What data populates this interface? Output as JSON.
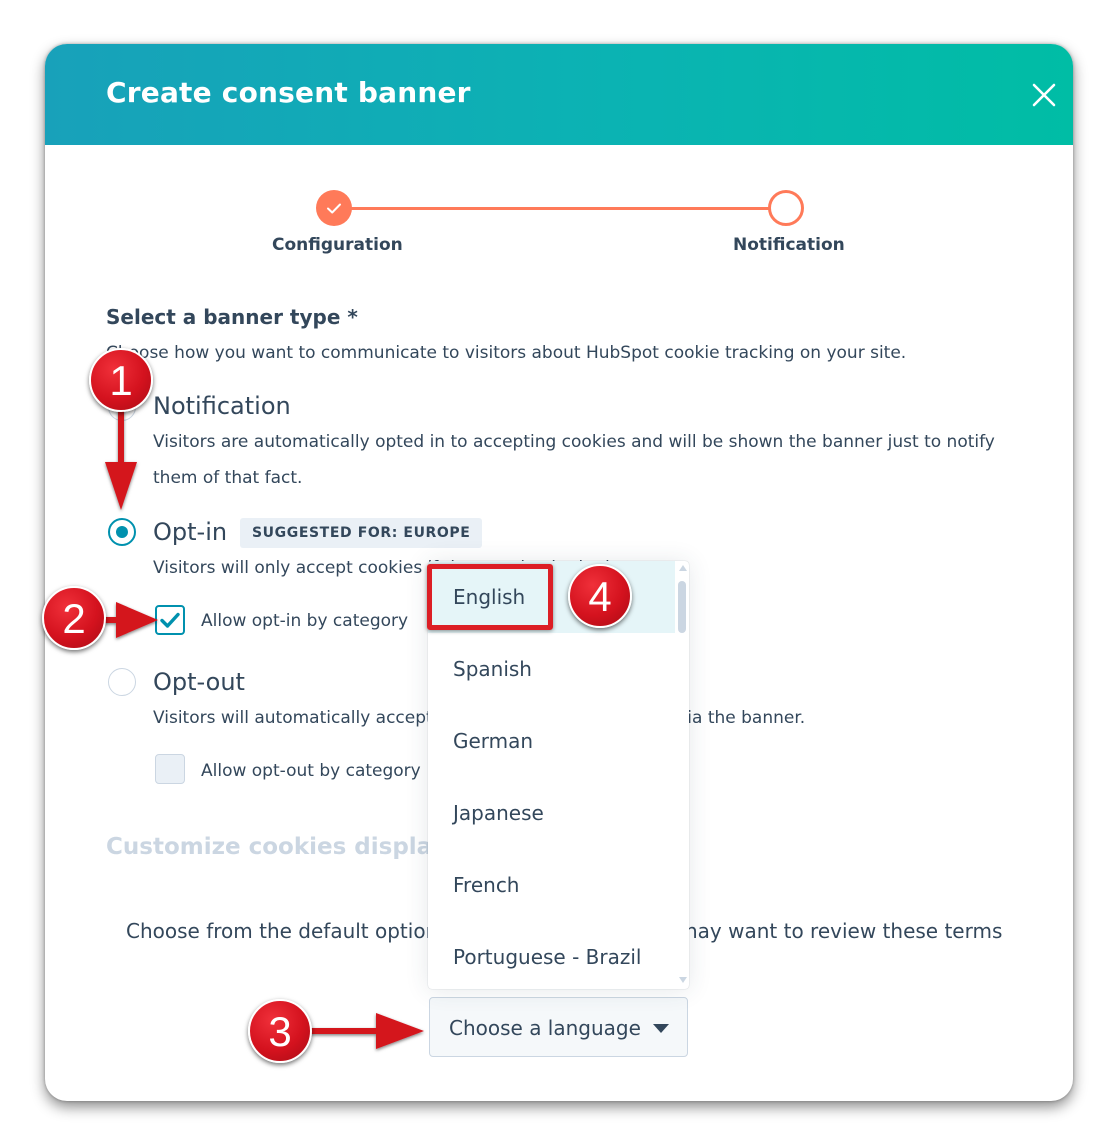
{
  "modal": {
    "title": "Create consent banner",
    "close_icon": "close-icon"
  },
  "stepper": {
    "steps": [
      {
        "label": "Configuration",
        "state": "completed"
      },
      {
        "label": "Notification",
        "state": "pending"
      }
    ],
    "accent_color": "#ff7a59"
  },
  "banner_type": {
    "title": "Select a banner type *",
    "description": "Choose how you want to communicate to visitors about HubSpot cookie tracking on your site.",
    "options": [
      {
        "label": "Notification",
        "selected": false,
        "description_line1": "Visitors are automatically opted in to accepting cookies and will be shown the banner just to notify",
        "description_line2": "them of that fact."
      },
      {
        "label": "Opt-in",
        "selected": true,
        "badge": "SUGGESTED FOR: EUROPE",
        "description": "Visitors will only accept cookies if they opt in via the banner.",
        "checkbox_label": "Allow opt-in by category",
        "checkbox_checked": true
      },
      {
        "label": "Opt-out",
        "selected": false,
        "description": "Visitors will automatically accept cookies unless they opt out via the banner.",
        "checkbox_label": "Allow opt-out by category",
        "checkbox_checked": false
      }
    ]
  },
  "customize": {
    "title": "Customize cookies display",
    "text_left": "Choose from the default option",
    "text_right": "nay want to review these terms"
  },
  "language": {
    "button_label": "Choose a language",
    "options": [
      "English",
      "Spanish",
      "German",
      "Japanese",
      "French",
      "Portuguese - Brazil"
    ],
    "highlighted": "English"
  },
  "annotations": {
    "markers": [
      "1",
      "2",
      "3",
      "4"
    ],
    "color": "#d4121e"
  },
  "colors": {
    "header_gradient_start": "#18a1ba",
    "header_gradient_end": "#00bda5",
    "primary_teal": "#0091ae",
    "text": "#33475b"
  }
}
